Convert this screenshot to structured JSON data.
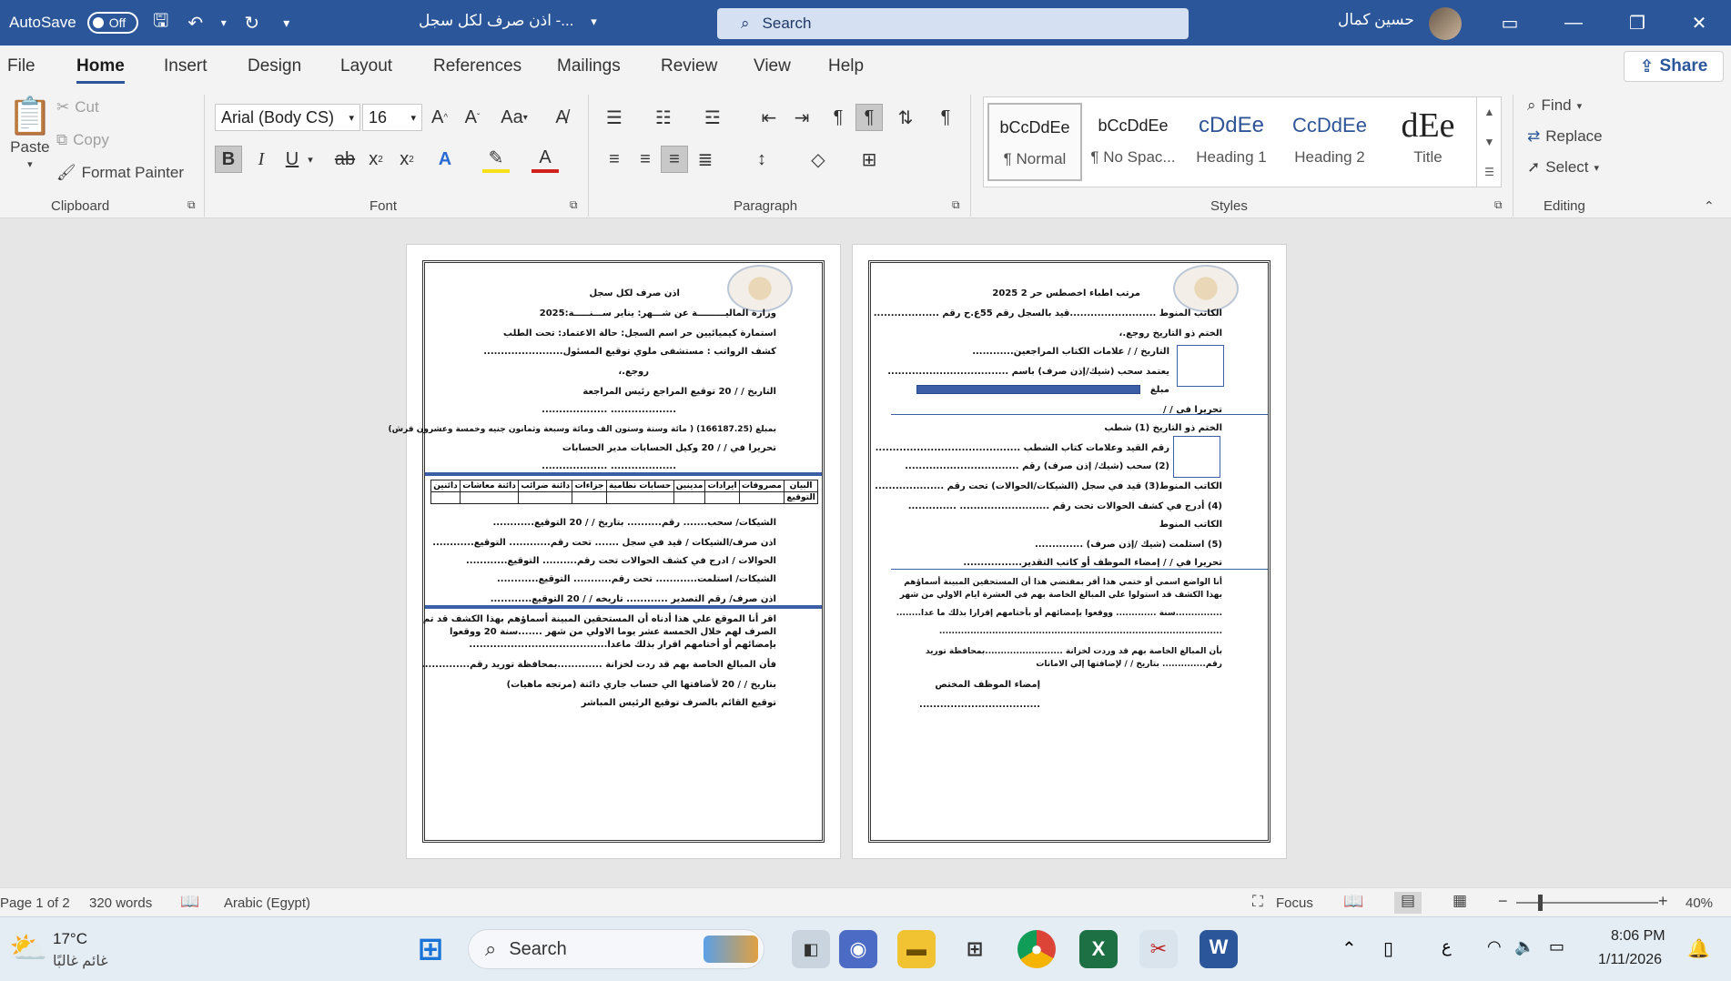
{
  "titlebar": {
    "autosave_label": "AutoSave",
    "autosave_state": "Off",
    "doc_title": "اذن صرف لكل سجل  -...",
    "search_placeholder": "Search",
    "user_name": "حسين كمال"
  },
  "tabs": [
    "File",
    "Home",
    "Insert",
    "Design",
    "Layout",
    "References",
    "Mailings",
    "Review",
    "View",
    "Help"
  ],
  "share_label": "Share",
  "ribbon": {
    "clipboard": {
      "paste": "Paste",
      "cut": "Cut",
      "copy": "Copy",
      "format_painter": "Format Painter",
      "label": "Clipboard"
    },
    "font": {
      "name": "Arial (Body CS)",
      "size": "16",
      "label": "Font",
      "case_btn": "Aa"
    },
    "paragraph": {
      "label": "Paragraph"
    },
    "styles": {
      "label": "Styles",
      "items": [
        {
          "preview": "bCcDdEe",
          "name": "¶ Normal"
        },
        {
          "preview": "bCcDdEe",
          "name": "¶ No Spac..."
        },
        {
          "preview": "cDdEe",
          "name": "Heading 1"
        },
        {
          "preview": "CcDdEe",
          "name": "Heading 2"
        },
        {
          "preview": "dEe",
          "name": "Title"
        }
      ]
    },
    "editing": {
      "find": "Find",
      "replace": "Replace",
      "select": "Select",
      "label": "Editing"
    }
  },
  "page1": {
    "lines": [
      "اذن صرف لكل سجل",
      "وزارة الماليـــــــــة                عن شـــهر: يناير   ســـنـــــة:2025",
      "استمارة  كيميائيين حر        اسم السجل:        حالة الاعتماد: تحت الطلب",
      "كشف الرواتب : مستشفى ملوي                توقيع المسئول.......................",
      "روجع.،",
      "التاريخ    /    /    20       توقيع المراجع                  رئيس المراجعة",
      "...................                ...................",
      "بمبلغ (166187.25)  (  مائة وستة وستون الف ومائة وسبعة وثمانون جنيه وخمسة وعشرون قرش)",
      "تحريرا في    /    /    20       وكيل الحسابات             مدير الحسابات",
      "...................                ...................",
      "الشيكات/ سحب.......   رقم..........  بتاريخ    /   /  20 التوقيع............",
      "اذن صرف/الشيكات / قيد في سجل .......  تحت رقم............ التوقيع............",
      "الحوالات / ادرج في كشف الحوالات  تحت رقم..........          التوقيع............",
      "الشيكات/ استلمت............  تحت رقم...........          التوقيع............",
      "اذن صرف/ رقم التصدير ............  تاريخه    /   /  20  التوقيع............",
      "اقر أنا الموقع علي هذا أدناه أن المستحقين المبينة أسماؤهم بهذا الكشف قد تم",
      "الصرف لهم خلال الخمسة عشر يوما الاولي من شهر .......سنة     20   ووقعوا",
      "بإمضائهم أو أختامهم اقرار بذلك ماعدا........................................",
      "فأن المبالغ الخاصة بهم قد ردت لخزانة .............بمحافظة توريد رقم..............",
      "بتاريخ    /    /    20   لأضافتها الي حساب جاري دائنة (مرتجه ماهيات)",
      "توقيع القائم بالصرف                         توقيع الرئيس المباشر"
    ],
    "table_headers": [
      "البيان",
      "مصروفات",
      "ايرادات",
      "مدينين",
      "حسابات نظامية",
      "جزاءات",
      "دائنة ضرائب",
      "دائنة معاشات",
      "دائنين"
    ],
    "table_row_label": "التوقيع"
  },
  "page2": {
    "lines": [
      "مرتب اطباء اخصطس حر 2  2025",
      "الكاتب المنوط .........................قيد بالسجل رقم 55ع.ح رقم ...................",
      "الختم ذو التاريخ                               روجع.،",
      "التاريخ     /     /      علامات الكتاب المراجعين............",
      "يعتمد سحب (شيك/إذن صرف) باسم ...................................",
      "مبلغ",
      "تحريرا في    /    /",
      "الختم ذو التاريخ (1) شطب",
      "رقم القيد وعلامات كتاب الشطب ..........................................",
      "(2)  سحب (شيك/ إذن صرف) رقم .................................",
      "الكاتب المنوط(3) قيد في سجل (الشيكات/الحوالات) تحت رقم ....................",
      "(4) أدرج في كشف الحوالات تحت رقم .......................... ..............",
      "الكاتب المنوط",
      "(5) استلمت (شيك /إذن صرف) ..............",
      "تحريرا في    /    /       إمضاء الموظف أو كاتب التقدير.................",
      "أنا الواضع اسمي أو ختمي هذا أقر بمقتضي هذا أن المستحقين المبينة أسماؤهم",
      "بهذا الكشف قد استولوا علي المبالغ الخاصة بهم في العشرة ايام الاولي من شهر",
      "...............سنة ............. ووقعوا بإمضائهم أو بأختامهم إقرارا بذلك ما عدا........",
      "...........................................................................................",
      "بأن المبالغ الخاصة بهم قد وردت لخزانة .........................بمحافظة توريد",
      "رقم.............. بتاريخ     /     /      لإضافتها إلي الامانات",
      "إمضاء الموظف المختص",
      "..................................."
    ]
  },
  "statusbar": {
    "page": "Page 1 of 2",
    "words": "320 words",
    "language": "Arabic (Egypt)",
    "focus": "Focus",
    "zoom": "40%"
  },
  "taskbar": {
    "temp": "17°C",
    "weather": "غائم غالبًا",
    "search": "Search",
    "time": "8:06 PM",
    "date": "1/11/2026",
    "lang": "ع"
  },
  "colors": {
    "word_blue": "#2b579a",
    "doc_blue": "#3b5ea6"
  }
}
